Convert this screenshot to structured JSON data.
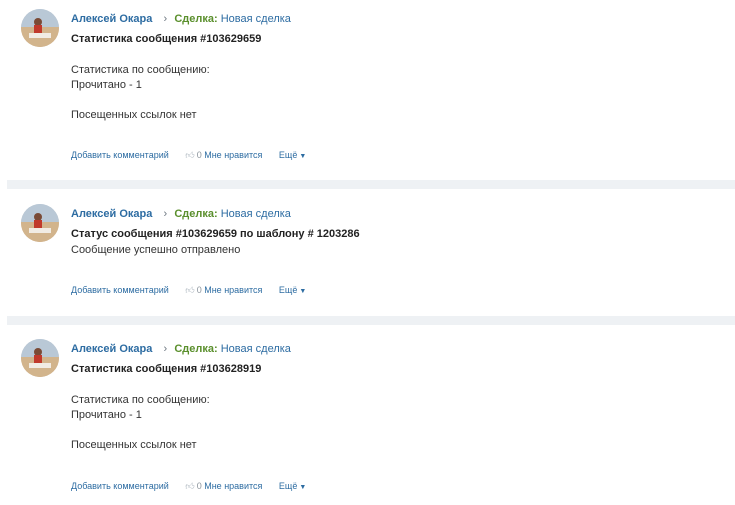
{
  "posts": [
    {
      "author": "Алексей Окара",
      "deal_label": "Сделка:",
      "deal_name": "Новая сделка",
      "title": "Статистика сообщения #103629659",
      "lines": [
        "Статистика по сообщению:",
        "Прочитано - 1",
        "",
        "Посещенных ссылок нет"
      ],
      "actions": {
        "comment": "Добавить комментарий",
        "like_count": "0",
        "like": "Мне нравится",
        "more": "Ещё"
      }
    },
    {
      "author": "Алексей Окара",
      "deal_label": "Сделка:",
      "deal_name": "Новая сделка",
      "title": "Статус сообщения #103629659 по шаблону # 1203286",
      "lines": [
        "Сообщение успешно отправлено"
      ],
      "actions": {
        "comment": "Добавить комментарий",
        "like_count": "0",
        "like": "Мне нравится",
        "more": "Ещё"
      }
    },
    {
      "author": "Алексей Окара",
      "deal_label": "Сделка:",
      "deal_name": "Новая сделка",
      "title": "Статистика сообщения #103628919",
      "lines": [
        "Статистика по сообщению:",
        "Прочитано - 1",
        "",
        "Посещенных ссылок нет"
      ],
      "actions": {
        "comment": "Добавить комментарий",
        "like_count": "0",
        "like": "Мне нравится",
        "more": "Ещё"
      }
    }
  ],
  "colors": {
    "link": "#2d6ca2",
    "deal_label": "#5a8f2c",
    "divider": "#eef1f4"
  }
}
